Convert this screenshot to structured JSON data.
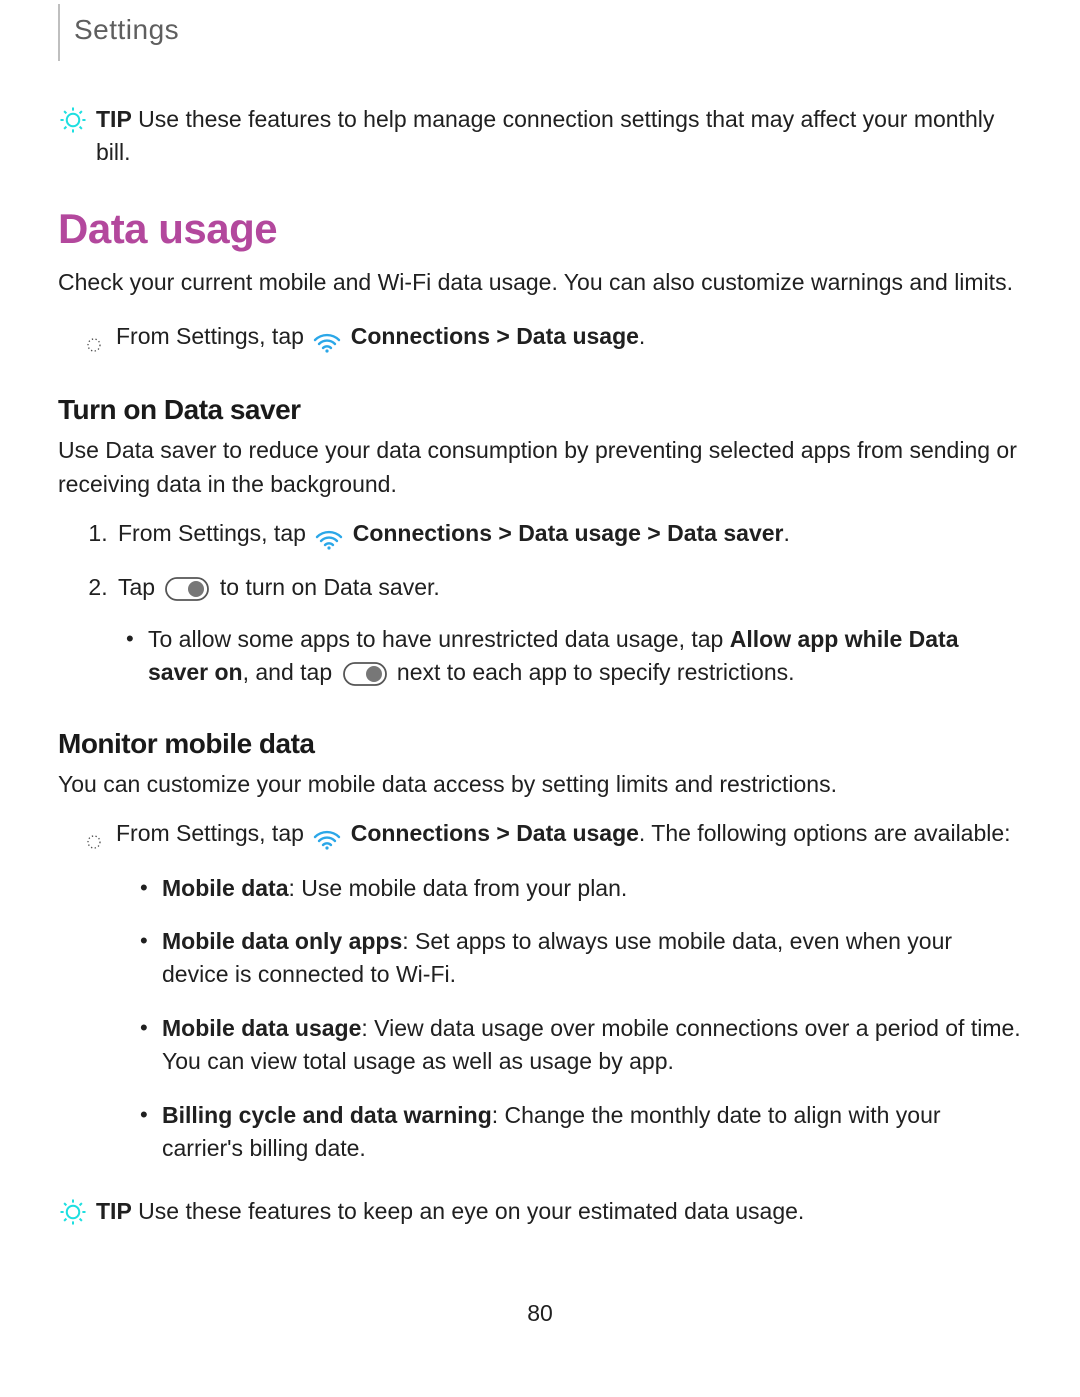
{
  "breadcrumb": "Settings",
  "tip1": {
    "label": "TIP",
    "text": " Use these features to help manage connection settings that may affect your monthly bill."
  },
  "section": {
    "title": "Data usage",
    "lead": "Check your current mobile and Wi-Fi data usage. You can also customize warnings and limits.",
    "nav_prefix": "From Settings, tap ",
    "nav_bold": "Connections > Data usage",
    "nav_suffix": "."
  },
  "saver": {
    "heading": "Turn on Data saver",
    "lead": "Use Data saver to reduce your data consumption by preventing selected apps from sending or receiving data in the background.",
    "step1_prefix": "From Settings, tap ",
    "step1_bold": "Connections > Data usage > Data saver",
    "step1_suffix": ".",
    "step2_prefix": "Tap ",
    "step2_suffix": " to turn on Data saver.",
    "sub_a_prefix": "To allow some apps to have unrestricted data usage, tap ",
    "sub_a_bold": "Allow app while Data saver on",
    "sub_a_mid": ", and tap ",
    "sub_a_suffix": " next to each app to specify restrictions."
  },
  "monitor": {
    "heading": "Monitor mobile data",
    "lead": "You can customize your mobile data access by setting limits and restrictions.",
    "nav_prefix": "From Settings, tap ",
    "nav_bold": "Connections > Data usage",
    "nav_suffix": ". The following options are available:",
    "opts": [
      {
        "label": "Mobile data",
        "text": ": Use mobile data from your plan."
      },
      {
        "label": "Mobile data only apps",
        "text": ": Set apps to always use mobile data, even when your device is connected to Wi-Fi."
      },
      {
        "label": "Mobile data usage",
        "text": ": View data usage over mobile connections over a period of time. You can view total usage as well as usage by app."
      },
      {
        "label": "Billing cycle and data warning",
        "text": ": Change the monthly date to align with your carrier's billing date."
      }
    ]
  },
  "tip2": {
    "label": "TIP",
    "text": " Use these features to keep an eye on your estimated data usage."
  },
  "page_number": "80",
  "colors": {
    "accent_magenta": "#b3489d",
    "accent_cyan": "#1edfe0",
    "wifi_blue": "#2ba7e8"
  }
}
